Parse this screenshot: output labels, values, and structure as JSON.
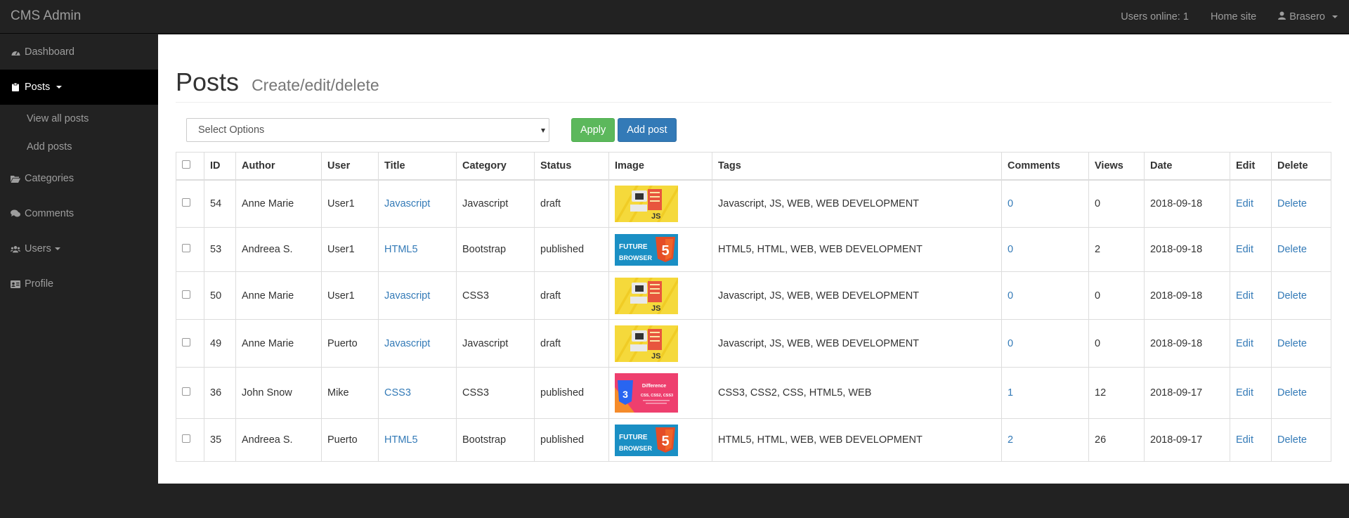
{
  "navbar": {
    "brand": "CMS Admin",
    "users_online": "Users online: 1",
    "home_site": "Home site",
    "user_name": "Brasero"
  },
  "sidebar": {
    "items": [
      {
        "label": "Dashboard",
        "icon": "dashboard-icon"
      },
      {
        "label": "Posts",
        "icon": "clipboard-icon"
      },
      {
        "label": "Categories",
        "icon": "folder-open-icon"
      },
      {
        "label": "Comments",
        "icon": "comments-icon"
      },
      {
        "label": "Users",
        "icon": "users-icon"
      },
      {
        "label": "Profile",
        "icon": "id-card-icon"
      }
    ],
    "posts_sub": [
      "View all posts",
      "Add posts"
    ]
  },
  "page": {
    "title": "Posts",
    "subtitle": "Create/edit/delete"
  },
  "toolbar": {
    "select_value": "Select Options",
    "apply_label": "Apply",
    "add_label": "Add post"
  },
  "table": {
    "headers": [
      "ID",
      "Author",
      "User",
      "Title",
      "Category",
      "Status",
      "Image",
      "Tags",
      "Comments",
      "Views",
      "Date",
      "Edit",
      "Delete"
    ],
    "rows": [
      {
        "id": "54",
        "author": "Anne Marie",
        "user": "User1",
        "title": "Javascript",
        "category": "Javascript",
        "status": "draft",
        "image": "js-thumbnail",
        "tags": "Javascript, JS, WEB, WEB DEVELOPMENT",
        "comments": "0",
        "views": "0",
        "date": "2018-09-18",
        "edit": "Edit",
        "delete": "Delete"
      },
      {
        "id": "53",
        "author": "Andreea S.",
        "user": "User1",
        "title": "HTML5",
        "category": "Bootstrap",
        "status": "published",
        "image": "html5-thumbnail",
        "tags": "HTML5, HTML, WEB, WEB DEVELOPMENT",
        "comments": "0",
        "views": "2",
        "date": "2018-09-18",
        "edit": "Edit",
        "delete": "Delete"
      },
      {
        "id": "50",
        "author": "Anne Marie",
        "user": "User1",
        "title": "Javascript",
        "category": "CSS3",
        "status": "draft",
        "image": "js-thumbnail",
        "tags": "Javascript, JS, WEB, WEB DEVELOPMENT",
        "comments": "0",
        "views": "0",
        "date": "2018-09-18",
        "edit": "Edit",
        "delete": "Delete"
      },
      {
        "id": "49",
        "author": "Anne Marie",
        "user": "Puerto",
        "title": "Javascript",
        "category": "Javascript",
        "status": "draft",
        "image": "js-thumbnail",
        "tags": "Javascript, JS, WEB, WEB DEVELOPMENT",
        "comments": "0",
        "views": "0",
        "date": "2018-09-18",
        "edit": "Edit",
        "delete": "Delete"
      },
      {
        "id": "36",
        "author": "John Snow",
        "user": "Mike",
        "title": "CSS3",
        "category": "CSS3",
        "status": "published",
        "image": "css3-thumbnail",
        "tags": "CSS3, CSS2, CSS, HTML5, WEB",
        "comments": "1",
        "views": "12",
        "date": "2018-09-17",
        "edit": "Edit",
        "delete": "Delete"
      },
      {
        "id": "35",
        "author": "Andreea S.",
        "user": "Puerto",
        "title": "HTML5",
        "category": "Bootstrap",
        "status": "published",
        "image": "html5-thumbnail",
        "tags": "HTML5, HTML, WEB, WEB DEVELOPMENT",
        "comments": "2",
        "views": "26",
        "date": "2018-09-17",
        "edit": "Edit",
        "delete": "Delete"
      }
    ]
  },
  "thumbnails": {
    "js": {
      "label": "JS"
    },
    "html5": {
      "line1": "FUTURE",
      "line2": "BROWSER",
      "badge": "5"
    },
    "css3": {
      "line1": "Difference",
      "line2": "CSS, CSS2, CSS3",
      "badge": "3"
    }
  },
  "colors": {
    "link": "#337ab7",
    "apply": "#5cb85c",
    "add": "#337ab7",
    "navbar": "#222222"
  }
}
